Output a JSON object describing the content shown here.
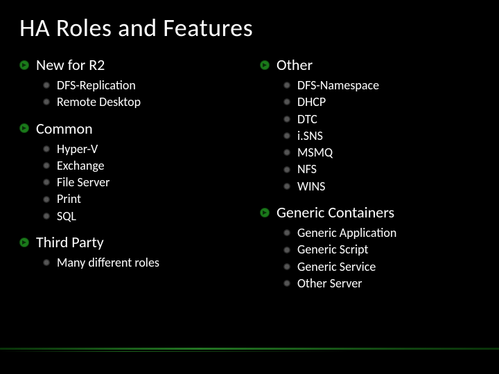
{
  "title": "HA Roles and Features",
  "left": [
    {
      "heading": "New for R2",
      "items": [
        "DFS-Replication",
        "Remote Desktop"
      ]
    },
    {
      "heading": "Common",
      "items": [
        "Hyper-V",
        "Exchange",
        "File Server",
        "Print",
        "SQL"
      ]
    },
    {
      "heading": "Third Party",
      "items": [
        "Many different roles"
      ]
    }
  ],
  "right": [
    {
      "heading": "Other",
      "items": [
        "DFS-Namespace",
        "DHCP",
        "DTC",
        "i.SNS",
        "MSMQ",
        "NFS",
        "WINS"
      ]
    },
    {
      "heading": "Generic Containers",
      "items": [
        "Generic Application",
        "Generic Script",
        "Generic Service",
        "Other Server"
      ]
    }
  ]
}
